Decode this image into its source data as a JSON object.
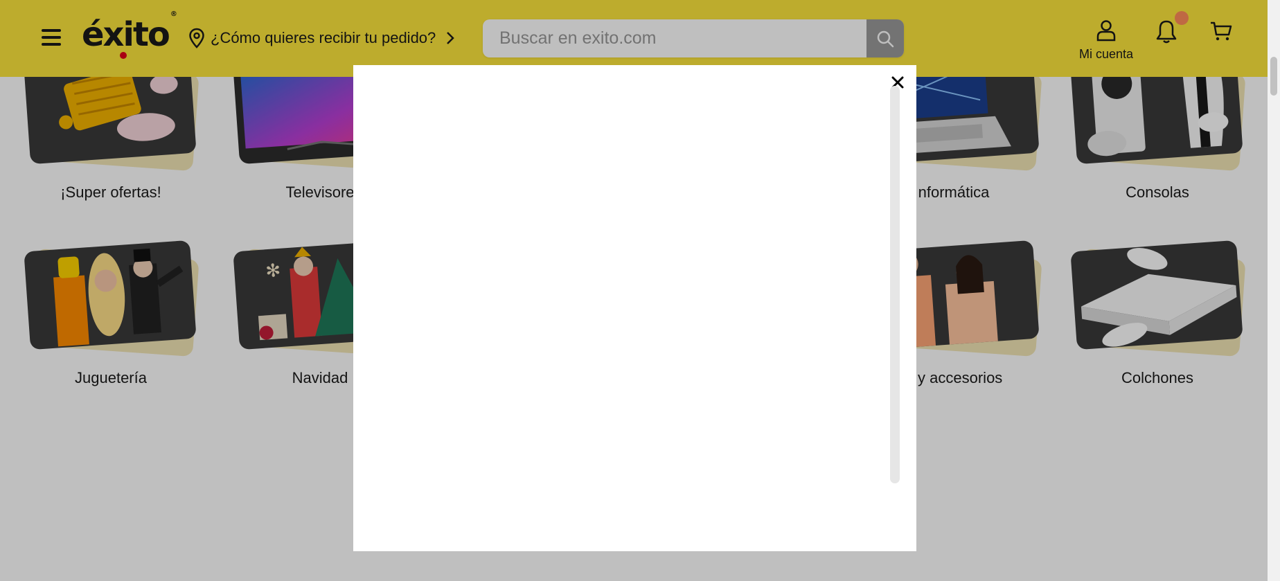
{
  "header": {
    "logo_text": "éxito",
    "logo_mark": "®",
    "delivery_text": "¿Cómo quieres recibir tu pedido?",
    "search_placeholder": "Buscar en exito.com",
    "account_label": "Mi cuenta",
    "icons": [
      "menu-icon",
      "location-pin-icon",
      "chevron-right-icon",
      "search-icon",
      "user-icon",
      "bell-icon",
      "cart-icon"
    ]
  },
  "categories_row1": [
    {
      "label": "¡Super ofertas!"
    },
    {
      "label": "Televisore"
    },
    {
      "label": "nformática"
    },
    {
      "label": "Consolas"
    }
  ],
  "categories_row2": [
    {
      "label": "Juguetería"
    },
    {
      "label": "Navidad"
    },
    {
      "label": "a y accesorios"
    },
    {
      "label": "Colchones"
    }
  ],
  "modal": {
    "close_icon": "close-icon"
  },
  "colors": {
    "brand_yellow": "#fde63d",
    "overlay": "rgba(0,0,0,0.25)",
    "notification": "#ff8c5a",
    "logo_dot": "#e2001a"
  }
}
